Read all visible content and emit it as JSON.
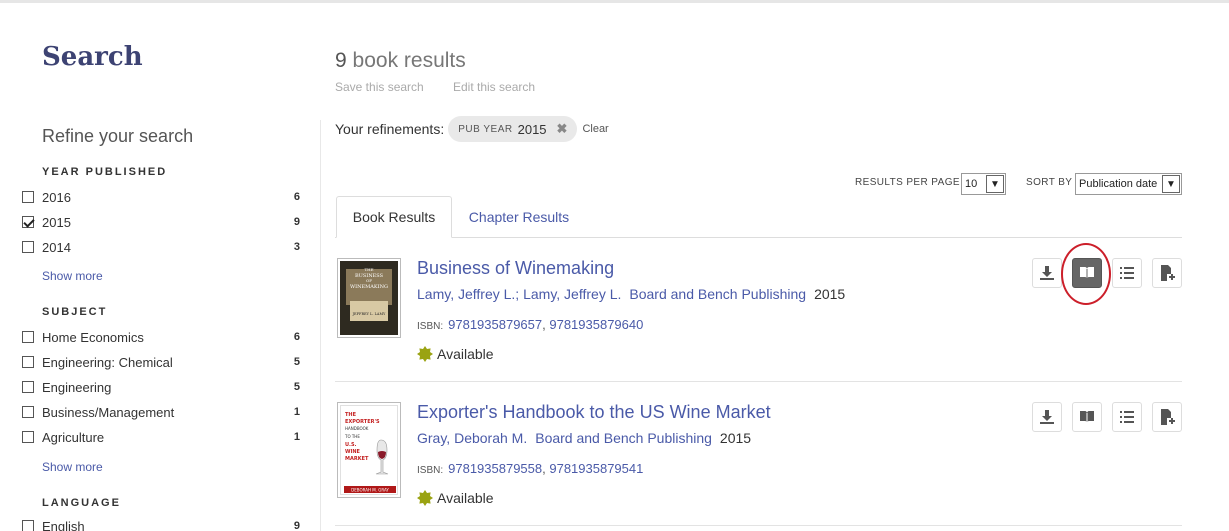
{
  "sidebar": {
    "title": "Search",
    "refine_title": "Refine your search",
    "facets": [
      {
        "heading": "YEAR PUBLISHED",
        "items": [
          {
            "label": "2016",
            "count": "6",
            "checked": false
          },
          {
            "label": "2015",
            "count": "9",
            "checked": true
          },
          {
            "label": "2014",
            "count": "3",
            "checked": false
          }
        ],
        "show_more": "Show more"
      },
      {
        "heading": "SUBJECT",
        "items": [
          {
            "label": "Home Economics",
            "count": "6",
            "checked": false
          },
          {
            "label": "Engineering: Chemical",
            "count": "5",
            "checked": false
          },
          {
            "label": "Engineering",
            "count": "5",
            "checked": false
          },
          {
            "label": "Business/Management",
            "count": "1",
            "checked": false
          },
          {
            "label": "Agriculture",
            "count": "1",
            "checked": false
          }
        ],
        "show_more": "Show more"
      },
      {
        "heading": "LANGUAGE",
        "items": [
          {
            "label": "English",
            "count": "9",
            "checked": false
          }
        ]
      }
    ]
  },
  "main": {
    "count_number": "9",
    "count_text": "book results",
    "save_search": "Save this search",
    "edit_search": "Edit this search",
    "refinements_label": "Your refinements:",
    "refinement": {
      "key": "PUB YEAR",
      "value": "2015",
      "remove": "✖"
    },
    "clear": "Clear",
    "results_per_page_label": "RESULTS PER PAGE",
    "results_per_page_value": "10",
    "sort_by_label": "SORT BY",
    "sort_by_value": "Publication date",
    "dropdown_arrow": "▼",
    "tabs": [
      {
        "label": "Book Results",
        "active": true
      },
      {
        "label": "Chapter Results",
        "active": false
      }
    ]
  },
  "results": [
    {
      "title": "Business of Winemaking",
      "authors": "Lamy, Jeffrey L.; Lamy, Jeffrey L.",
      "publisher": "Board and Bench Publishing",
      "year": "2015",
      "isbn_label": "ISBN:",
      "isbn1": "9781935879657",
      "isbn2": "9781935879640",
      "availability": "Available",
      "cover": {
        "line1": "THE",
        "line2": "BUSINESS",
        "line3": "OF",
        "line4": "WINEMAKING",
        "author": "JEFFREY L. LAMY"
      },
      "read_active": true
    },
    {
      "title": "Exporter's Handbook to the US Wine Market",
      "authors": "Gray, Deborah M.",
      "publisher": "Board and Bench Publishing",
      "year": "2015",
      "isbn_label": "ISBN:",
      "isbn1": "9781935879558",
      "isbn2": "9781935879541",
      "availability": "Available",
      "cover": {
        "line1": "THE",
        "line2": "EXPORTER'S",
        "line3": "HANDBOOK",
        "line4": "TO THE",
        "line5": "U.S.",
        "line6": "WINE",
        "line7": "MARKET",
        "author": "DEBORAH M. GRAY"
      },
      "read_active": false
    }
  ],
  "icons": {
    "download": "download-icon",
    "read": "book-open-icon",
    "toc": "list-icon",
    "add": "add-to-list-icon",
    "available": "available-badge-icon"
  },
  "colors": {
    "link": "#4a5aa8",
    "brand_title": "#3d4373",
    "highlight_circle": "#cc1f2a",
    "available_badge": "#9aa312"
  }
}
